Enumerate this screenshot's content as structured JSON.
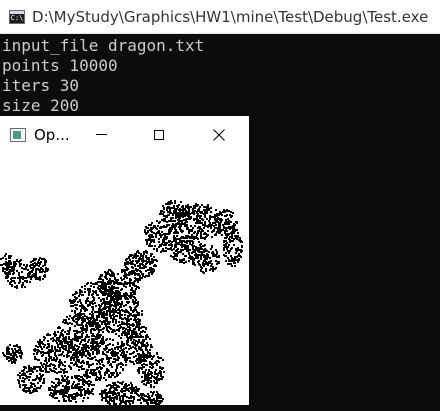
{
  "console": {
    "title": "D:\\MyStudy\\Graphics\\HW1\\mine\\Test\\Debug\\Test.exe",
    "icon": "console-app-icon",
    "lines": [
      "input_file dragon.txt",
      "points 10000",
      "iters 30",
      "size 200"
    ]
  },
  "gl_window": {
    "title": "Op...",
    "icon": "opengl-app-icon",
    "caption_buttons": [
      "minimize-icon",
      "maximize-icon",
      "close-icon"
    ],
    "render": {
      "description_colors": {
        "background": "#ffffff",
        "points": "#000000"
      }
    }
  }
}
